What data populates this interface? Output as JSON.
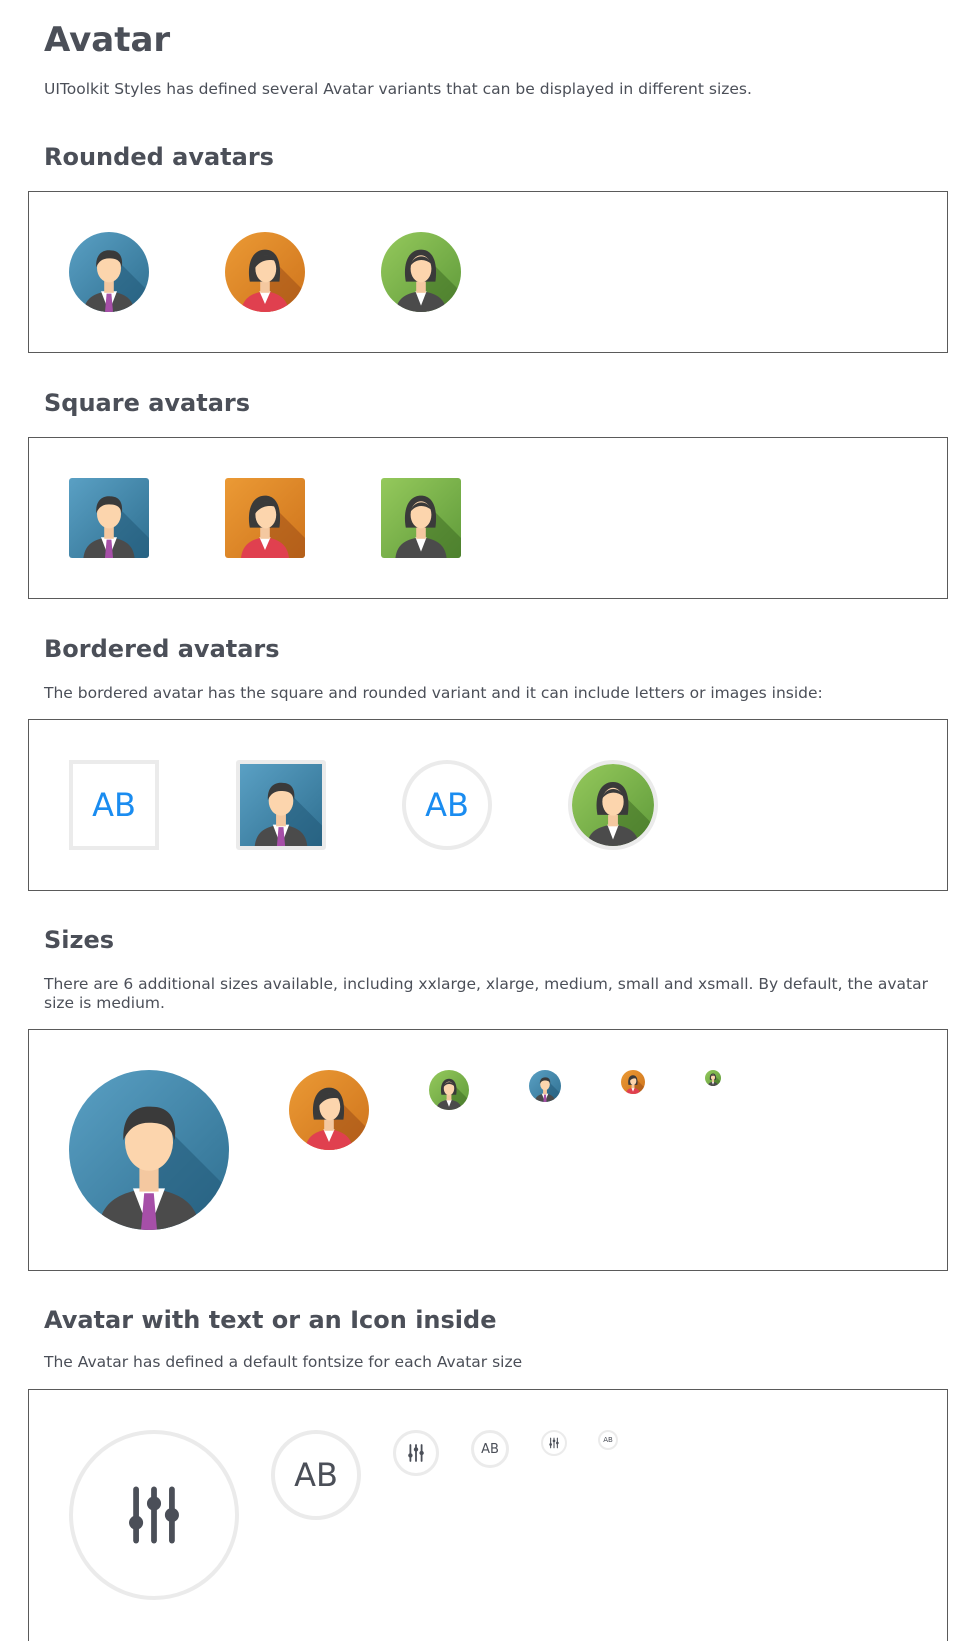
{
  "page": {
    "title": "Avatar",
    "intro": "UIToolkit Styles has defined several Avatar variants that can be displayed in different sizes."
  },
  "sections": {
    "rounded": {
      "title": "Rounded avatars"
    },
    "square": {
      "title": "Square avatars"
    },
    "bordered": {
      "title": "Bordered avatars",
      "description": "The bordered avatar has the square and rounded variant and it can include letters or images inside:",
      "initials": "AB"
    },
    "sizes": {
      "title": "Sizes",
      "description": "There are 6 additional sizes available, including xxlarge, xlarge, medium, small and xsmall. By default, the avatar size is medium."
    },
    "text_icon": {
      "title": "Avatar with text or an Icon inside",
      "description": "The Avatar has defined a default fontsize for each Avatar size",
      "initials": "AB"
    }
  },
  "avatar_colors": {
    "blue": "#4a87aa",
    "orange": "#e08a2a",
    "green": "#7fb84e",
    "bordered_letters": "#1a8cf0",
    "border": "#ebebeb"
  },
  "icons": {
    "avatar_man": "person-man-icon",
    "avatar_woman": "person-woman-icon",
    "sliders": "sliders-icon"
  }
}
